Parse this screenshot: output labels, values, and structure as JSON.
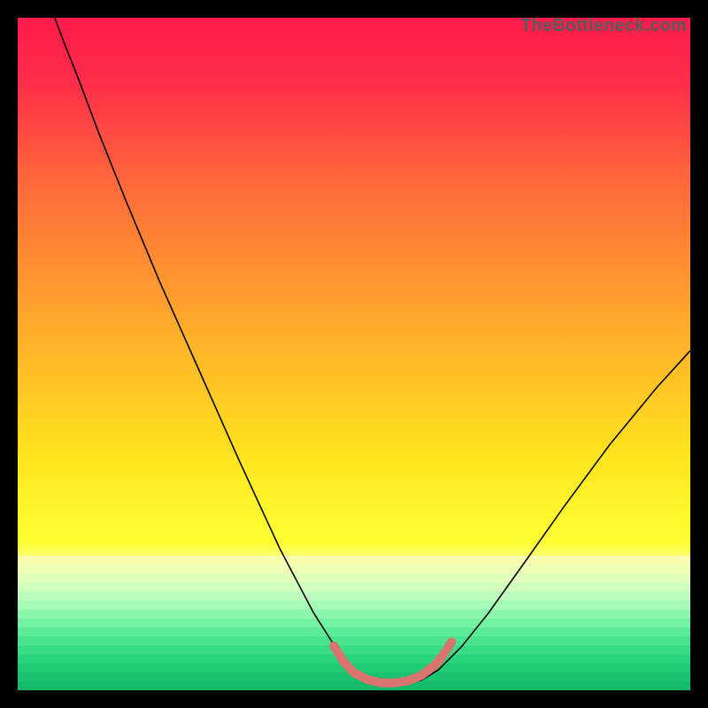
{
  "watermark": "TheBottleneck.com",
  "chart_data": {
    "type": "line",
    "title": "",
    "xlabel": "",
    "ylabel": "",
    "xlim": [
      0,
      100
    ],
    "ylim": [
      0,
      100
    ],
    "background_gradient_stops": [
      {
        "offset": 0.0,
        "color": "#ff1a4b"
      },
      {
        "offset": 0.1,
        "color": "#ff2f49"
      },
      {
        "offset": 0.25,
        "color": "#ff6a3a"
      },
      {
        "offset": 0.45,
        "color": "#ffa82c"
      },
      {
        "offset": 0.65,
        "color": "#ffe41e"
      },
      {
        "offset": 0.78,
        "color": "#ffff33"
      },
      {
        "offset": 0.82,
        "color": "#faffa6"
      },
      {
        "offset": 0.865,
        "color": "#d6ffbf"
      },
      {
        "offset": 0.905,
        "color": "#8cf7a8"
      },
      {
        "offset": 0.945,
        "color": "#3fe98d"
      },
      {
        "offset": 0.975,
        "color": "#19d877"
      },
      {
        "offset": 1.0,
        "color": "#12bd6a"
      }
    ],
    "bottom_band_stripes": [
      "#f9ffb0",
      "#eeffb6",
      "#e0ffbc",
      "#d0ffc0",
      "#bcfdbe",
      "#a4fab6",
      "#8cf6ac",
      "#74f1a2",
      "#5eeb97",
      "#49e48d",
      "#38dc84",
      "#2ad47c",
      "#20cb75",
      "#18c26f",
      "#14b969"
    ],
    "series": [
      {
        "name": "bottleneck-curve",
        "color": "#000000",
        "width": 1.6,
        "points": [
          {
            "x": 5.5,
            "y": 100.0
          },
          {
            "x": 7.0,
            "y": 96.0
          },
          {
            "x": 9.0,
            "y": 91.0
          },
          {
            "x": 12.0,
            "y": 83.0
          },
          {
            "x": 16.0,
            "y": 73.0
          },
          {
            "x": 21.0,
            "y": 61.0
          },
          {
            "x": 27.0,
            "y": 47.5
          },
          {
            "x": 33.0,
            "y": 34.0
          },
          {
            "x": 39.0,
            "y": 21.0
          },
          {
            "x": 44.0,
            "y": 11.5
          },
          {
            "x": 47.5,
            "y": 6.0
          },
          {
            "x": 50.0,
            "y": 3.0
          },
          {
            "x": 52.5,
            "y": 1.5
          },
          {
            "x": 55.0,
            "y": 1.0
          },
          {
            "x": 57.5,
            "y": 1.0
          },
          {
            "x": 60.0,
            "y": 1.5
          },
          {
            "x": 62.5,
            "y": 3.0
          },
          {
            "x": 66.0,
            "y": 6.5
          },
          {
            "x": 70.0,
            "y": 11.5
          },
          {
            "x": 75.0,
            "y": 18.5
          },
          {
            "x": 81.0,
            "y": 27.0
          },
          {
            "x": 88.0,
            "y": 36.5
          },
          {
            "x": 95.0,
            "y": 45.0
          },
          {
            "x": 100.0,
            "y": 50.5
          }
        ]
      }
    ],
    "highlight_band": {
      "name": "optimal-range-marker",
      "color": "#d9746e",
      "stroke_width": 10,
      "points": [
        {
          "x": 47.0,
          "y": 6.6
        },
        {
          "x": 48.5,
          "y": 4.2
        },
        {
          "x": 50.0,
          "y": 2.6
        },
        {
          "x": 52.0,
          "y": 1.6
        },
        {
          "x": 54.0,
          "y": 1.1
        },
        {
          "x": 56.0,
          "y": 1.1
        },
        {
          "x": 58.0,
          "y": 1.4
        },
        {
          "x": 60.0,
          "y": 2.2
        },
        {
          "x": 62.0,
          "y": 3.7
        },
        {
          "x": 63.5,
          "y": 5.6
        },
        {
          "x": 64.5,
          "y": 7.2
        }
      ]
    }
  }
}
